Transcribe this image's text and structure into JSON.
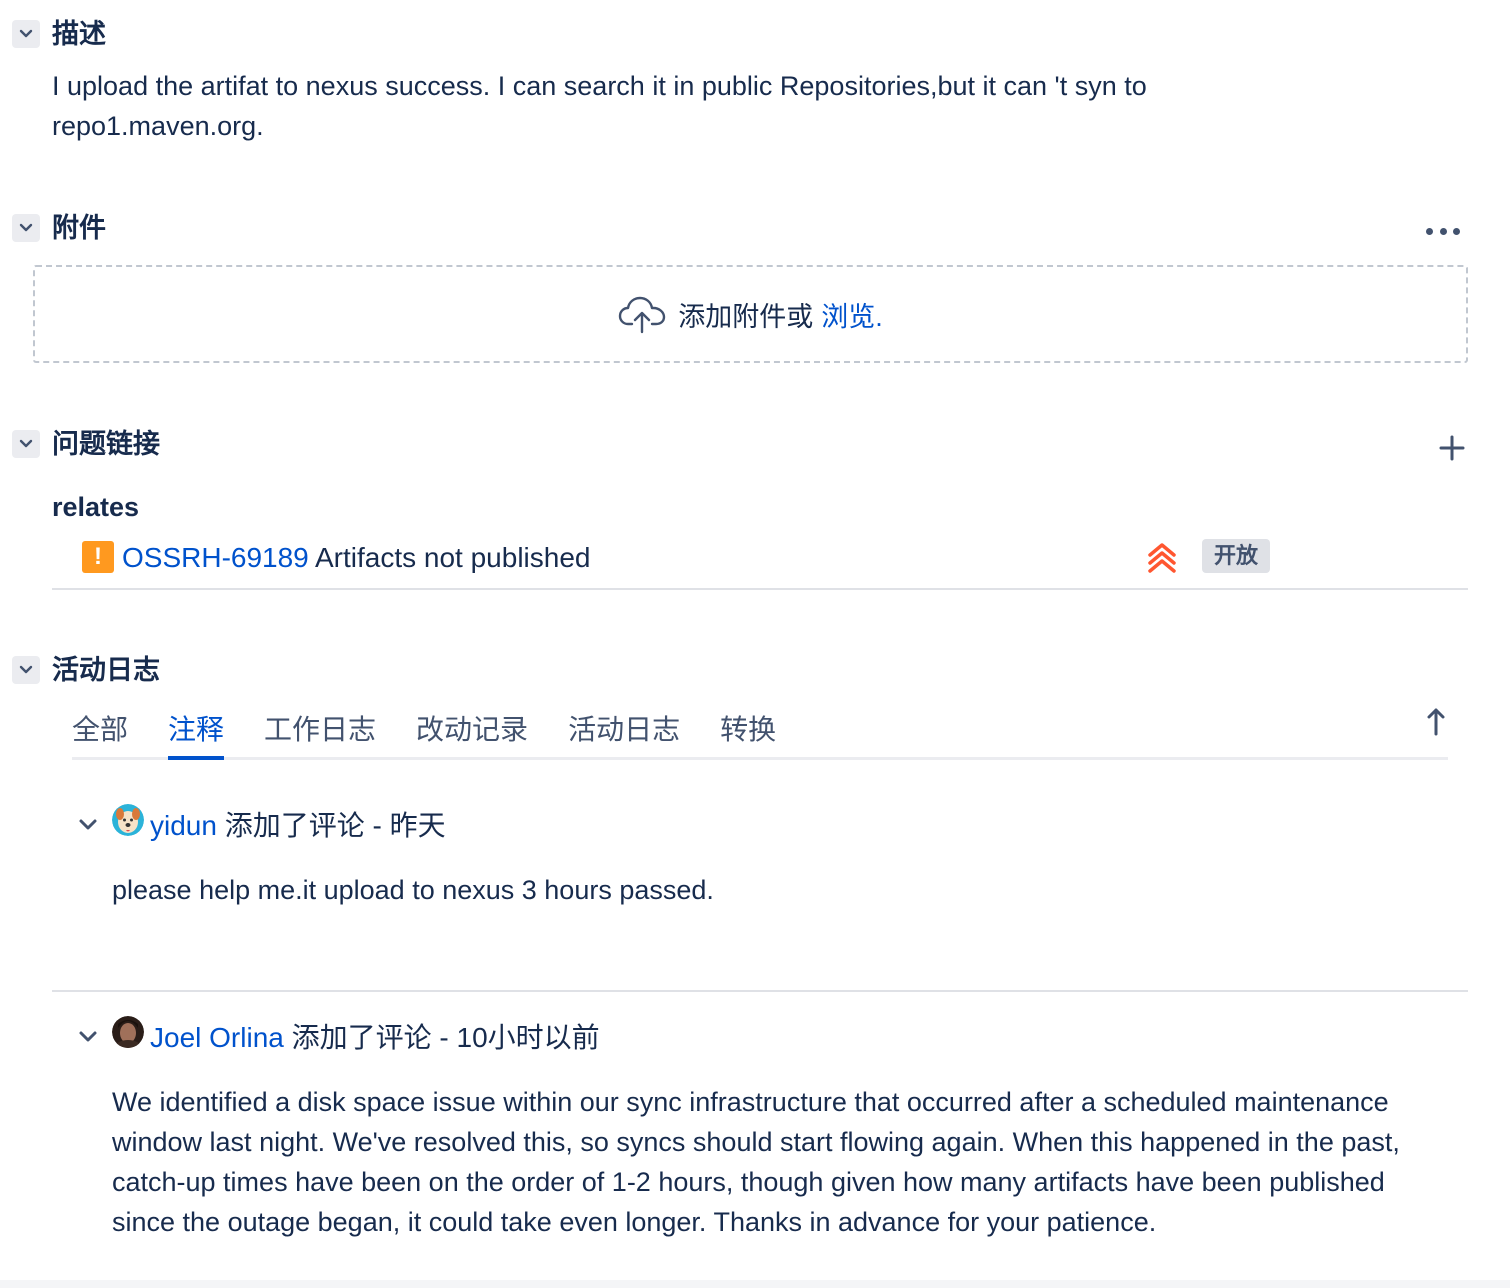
{
  "description": {
    "title": "描述",
    "text": "I upload the artifat to nexus success. I can search it in  public Repositories,but it can 't syn to repo1.maven.org."
  },
  "attachments": {
    "title": "附件",
    "drop_text": "添加附件或",
    "browse_link": "浏览."
  },
  "issue_links": {
    "title": "问题链接",
    "relation": "relates",
    "items": [
      {
        "key": "OSSRH-69189",
        "summary": "Artifacts not published",
        "status": "开放",
        "priority_color": "#ff5630"
      }
    ]
  },
  "activity": {
    "title": "活动日志",
    "tabs": [
      {
        "label": "全部",
        "active": false
      },
      {
        "label": "注释",
        "active": true
      },
      {
        "label": "工作日志",
        "active": false
      },
      {
        "label": "改动记录",
        "active": false
      },
      {
        "label": "活动日志",
        "active": false
      },
      {
        "label": "转换",
        "active": false
      }
    ],
    "comments": [
      {
        "author": "yidun",
        "action": "添加了评论 - 昨天",
        "body": "please help me.it upload to nexus 3 hours passed."
      },
      {
        "author": "Joel Orlina",
        "action": "添加了评论 - 10小时以前",
        "body": "We identified a disk space issue within our sync infrastructure that occurred after a scheduled maintenance window last night. We've resolved this, so syncs should start flowing again. When this happened in the past, catch-up times have been on the order of 1-2 hours, though given how many artifacts have been published since the outage began, it could take even longer. Thanks in advance for your patience."
      }
    ]
  },
  "colors": {
    "link": "#0052cc",
    "text": "#172b4d",
    "warning_icon": "#ff991f"
  }
}
